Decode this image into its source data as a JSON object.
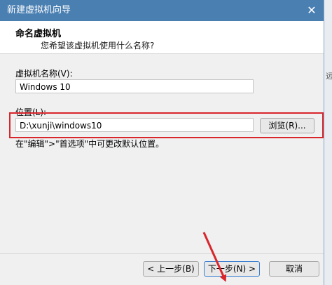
{
  "window": {
    "title": "新建虚拟机向导",
    "close_symbol": "✕"
  },
  "header": {
    "title": "命名虚拟机",
    "subtitle": "您希望该虚拟机使用什么名称?"
  },
  "form": {
    "name_label": "虚拟机名称(V):",
    "name_value": "Windows 10",
    "location_label": "位置(L):",
    "location_value": "D:\\xunji\\windows10",
    "browse_label": "浏览(R)...",
    "hint": "在\"编辑\">\"首选项\"中可更改默认位置。"
  },
  "footer": {
    "back_label": "< 上一步(B)",
    "next_label": "下一步(N) >",
    "cancel_label": "取消"
  },
  "side": {
    "partial_char": "远"
  },
  "colors": {
    "highlight": "#d8262c",
    "arrow": "#d8262c",
    "titlebar": "#4a7fb2"
  }
}
